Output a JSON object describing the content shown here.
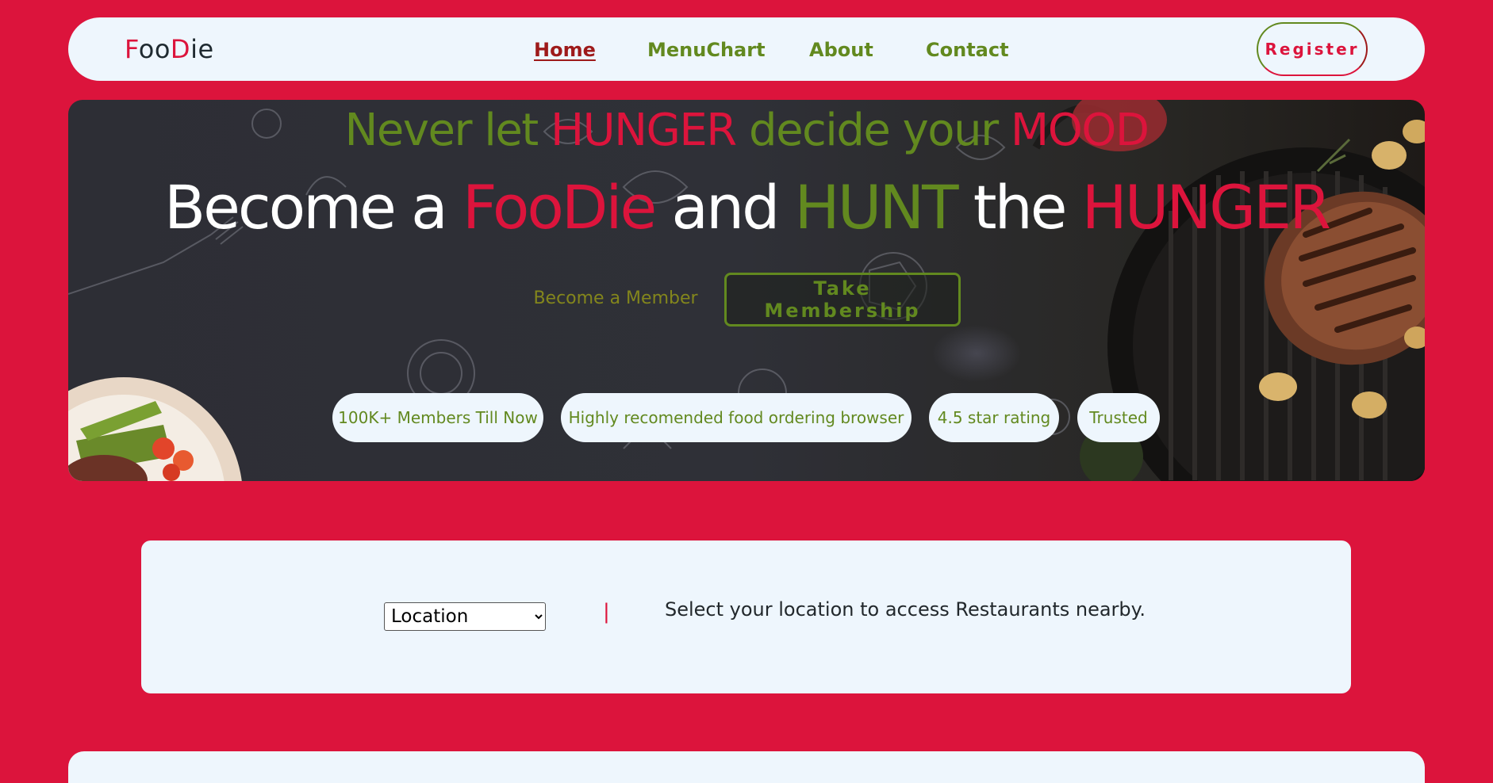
{
  "colors": {
    "brand_red": "#dc143c",
    "brand_green": "#62891f",
    "surface": "#eef6fd",
    "hero_dark": "#2d2e35"
  },
  "logo": {
    "part1": "F",
    "part2": "oo",
    "part3": "D",
    "part4": "ie"
  },
  "nav": {
    "items": [
      {
        "label": "Home",
        "active": true
      },
      {
        "label": "MenuChart",
        "active": false
      },
      {
        "label": "About",
        "active": false
      },
      {
        "label": "Contact",
        "active": false
      }
    ],
    "register_label": "Register"
  },
  "hero": {
    "tagline": {
      "w1": "Never let ",
      "w2": "HUNGER",
      "w3": " decide your ",
      "w4": "MOOD"
    },
    "headline": {
      "w1": "Become a ",
      "w2": "FooDie",
      "w3": " and ",
      "w4": "HUNT",
      "w5": " the ",
      "w6": "HUNGER"
    },
    "member_label": "Become a Member",
    "membership_button": "Take Membership",
    "badges": [
      "100K+ Members Till Now",
      "Highly recomended food ordering browser",
      "4.5 star rating",
      "Trusted"
    ]
  },
  "location": {
    "select_value": "Location",
    "divider": "|",
    "hint": "Select your location to access Restaurants nearby."
  }
}
